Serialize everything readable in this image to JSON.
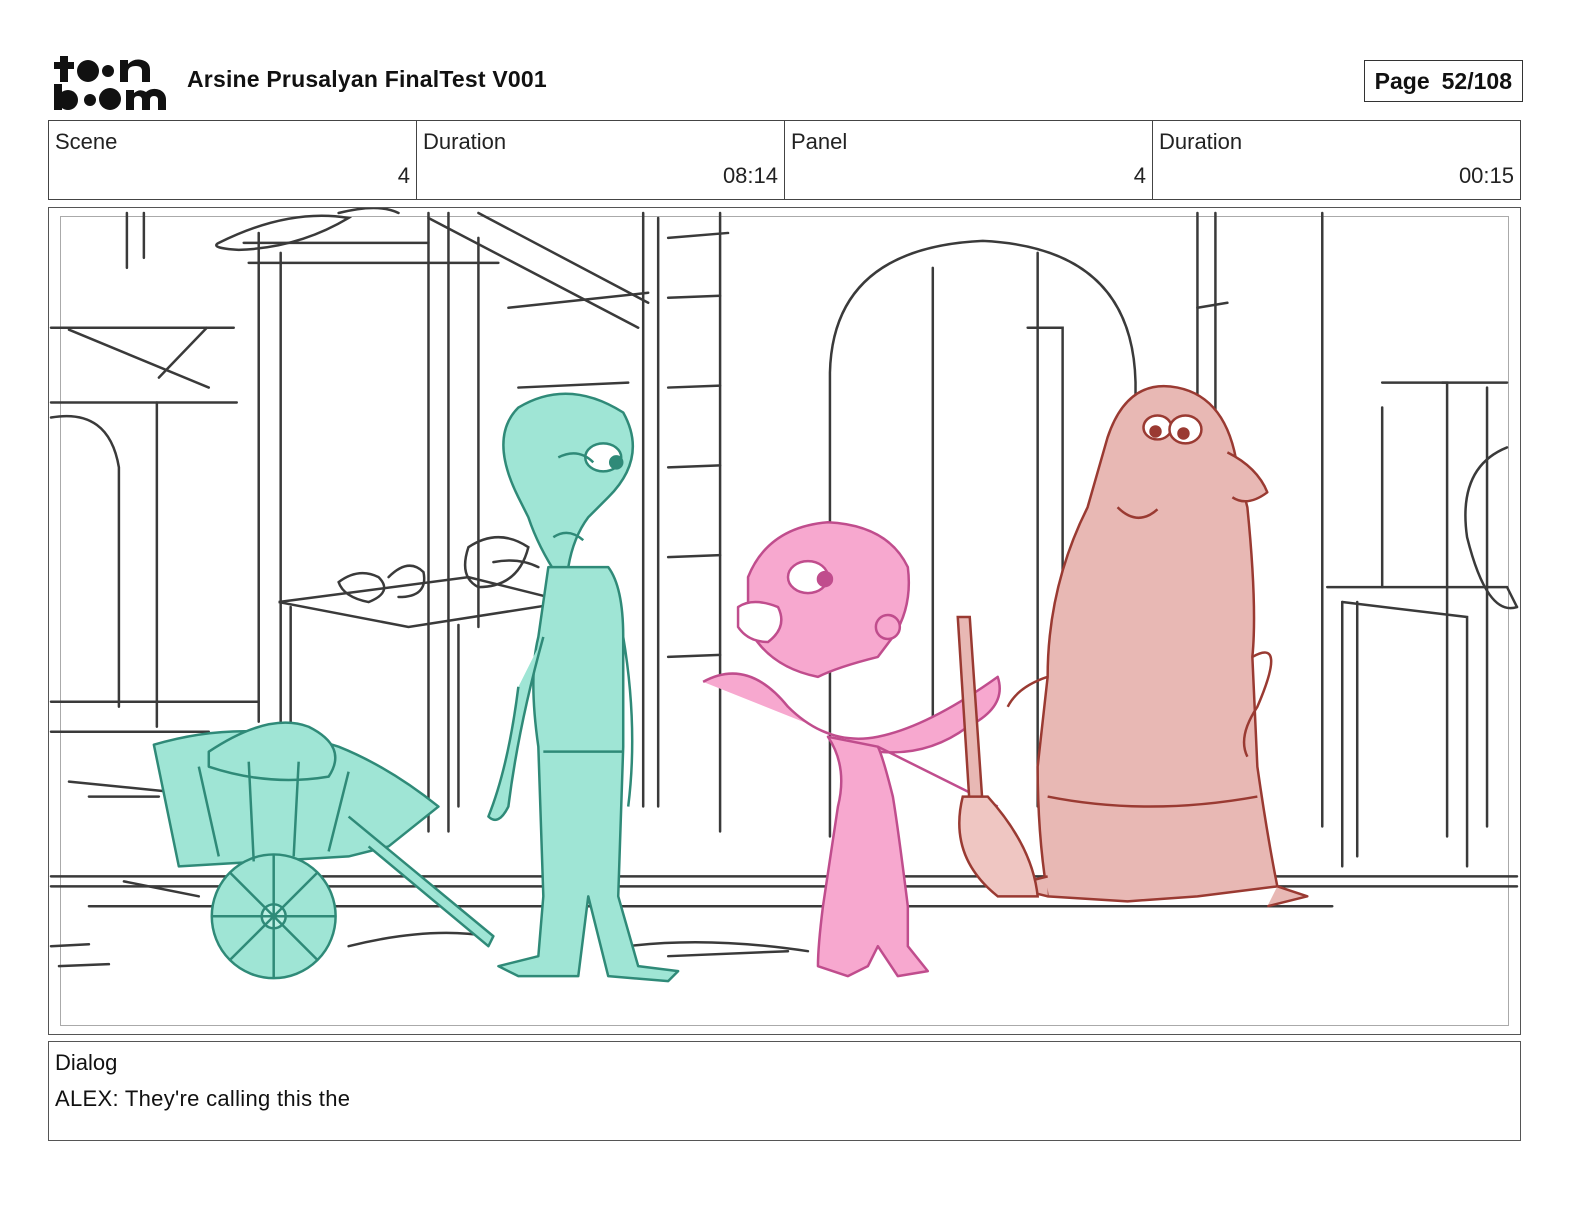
{
  "header": {
    "logo_text": "toon boom",
    "project_title": "Arsine Prusalyan FinalTest V001",
    "page_label": "Page",
    "page_number": "52/108"
  },
  "info": {
    "scene_label": "Scene",
    "scene_value": "4",
    "scene_duration_label": "Duration",
    "scene_duration_value": "08:14",
    "panel_label": "Panel",
    "panel_value": "4",
    "panel_duration_label": "Duration",
    "panel_duration_value": "00:15"
  },
  "panel": {
    "description_icons": [
      "wheelbarrow",
      "teal-character",
      "pink-character",
      "red-character-with-broom",
      "archway",
      "market-stall"
    ],
    "colors": {
      "line": "#3a3a3a",
      "teal_fill": "#9fe5d5",
      "teal_line": "#2f8a78",
      "pink_fill": "#f7a8cf",
      "pink_line": "#c04d8d",
      "red_fill": "#e8b8b4",
      "red_line": "#9a3a32"
    }
  },
  "dialog": {
    "label": "Dialog",
    "text": "ALEX: They're calling this the"
  }
}
